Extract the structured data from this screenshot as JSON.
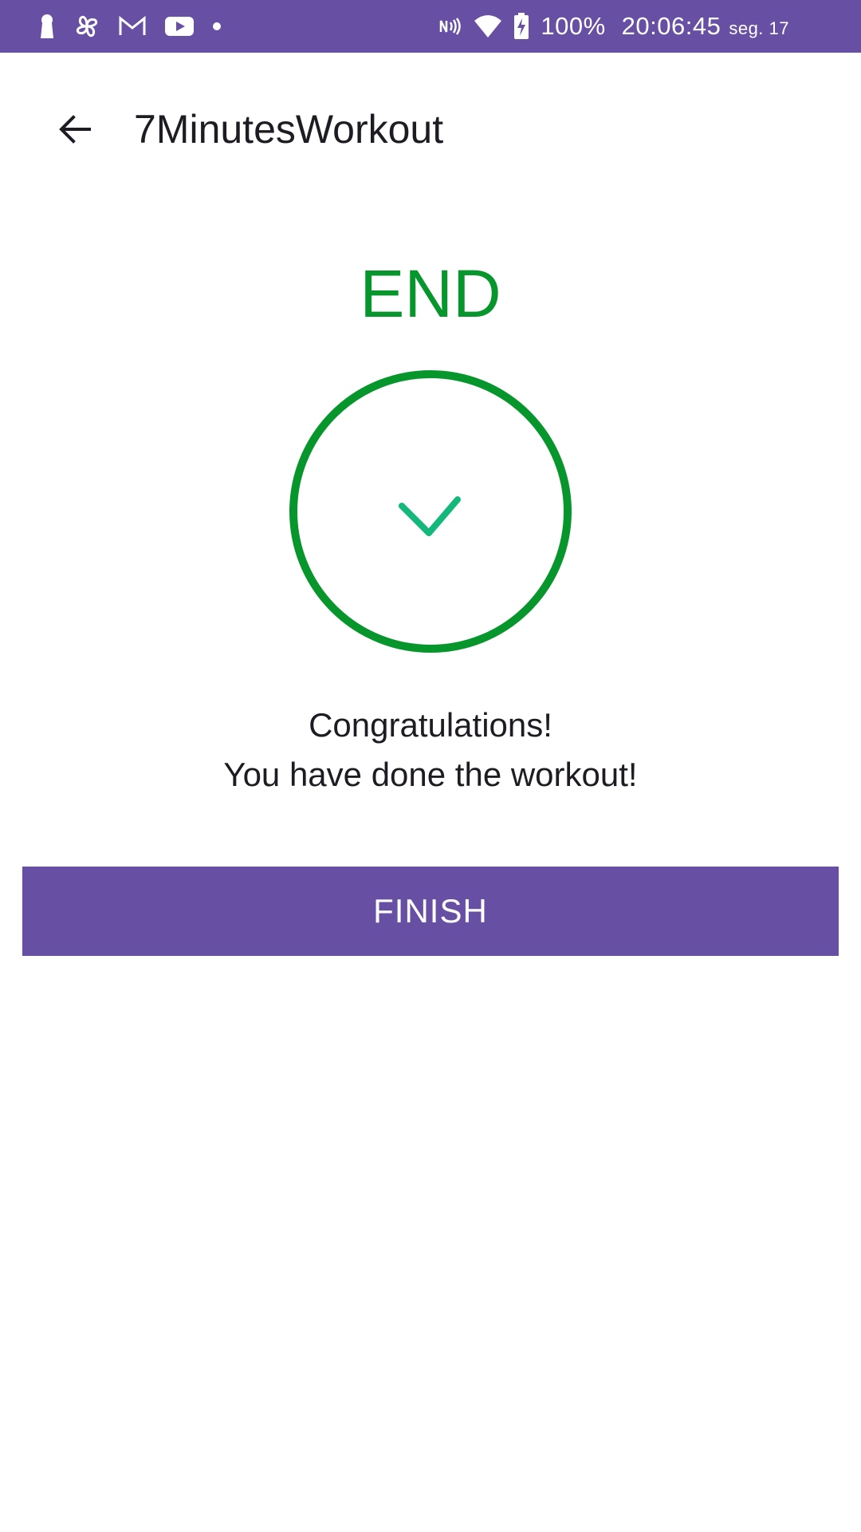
{
  "status_bar": {
    "background_color": "#6750a4",
    "left_icons": [
      "keyhole-icon",
      "pinwheel-icon",
      "gmail-icon",
      "youtube-icon",
      "dot-icon"
    ],
    "right_icons": [
      "nfc-icon",
      "wifi-icon",
      "battery-charging-icon"
    ],
    "battery": "100%",
    "time": "20:06:45",
    "date": "seg. 17"
  },
  "app_bar": {
    "back_icon": "arrow-back-icon",
    "title": "7MinutesWorkout"
  },
  "end_screen": {
    "title": "END",
    "title_color": "#07962b",
    "circle_color": "#07962b",
    "check_color": "#14b87a",
    "check_icon": "checkmark-icon",
    "message_line1": "Congratulations!",
    "message_line2": "You have done the workout!"
  },
  "finish_button": {
    "label": "FINISH",
    "color": "#6750a4"
  }
}
